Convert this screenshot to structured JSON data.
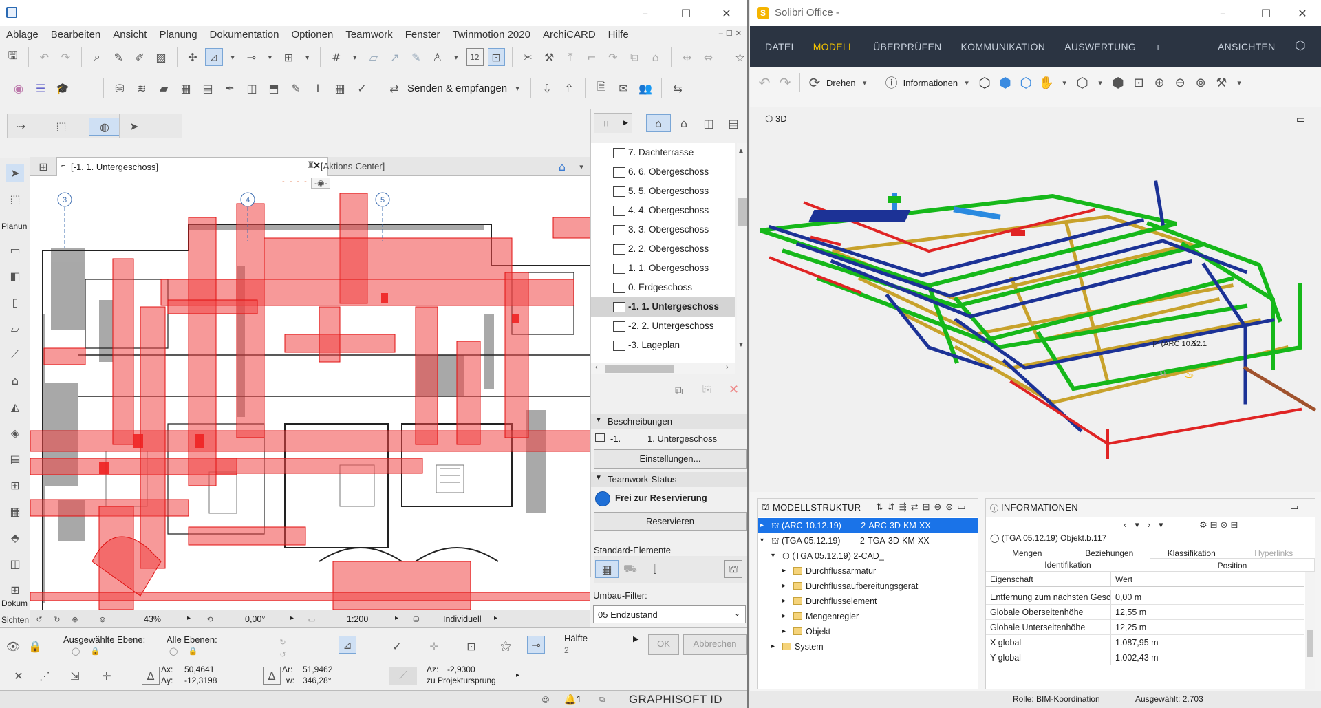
{
  "archicad": {
    "menu": [
      "Ablage",
      "Bearbeiten",
      "Ansicht",
      "Planung",
      "Dokumentation",
      "Optionen",
      "Teamwork",
      "Fenster",
      "Twinmotion 2020",
      "ArchiCARD",
      "Hilfe"
    ],
    "send_receive": "Senden & empfangen",
    "tabs": {
      "floorplan": "[-1. 1. Untergeschoss]",
      "action_center": "[Aktions-Center]"
    },
    "left_labels": {
      "planung": "Planun",
      "dokum": "Dokum",
      "sichten": "Sichten"
    },
    "grid_markers": [
      "3",
      "4",
      "5"
    ],
    "stories": [
      {
        "label": "7. Dachterrasse",
        "selected": false
      },
      {
        "label": "6. 6. Obergeschoss",
        "selected": false
      },
      {
        "label": "5. 5. Obergeschoss",
        "selected": false
      },
      {
        "label": "4. 4. Obergeschoss",
        "selected": false
      },
      {
        "label": "3. 3. Obergeschoss",
        "selected": false
      },
      {
        "label": "2. 2. Obergeschoss",
        "selected": false
      },
      {
        "label": "1. 1. Obergeschoss",
        "selected": false
      },
      {
        "label": "0. Erdgeschoss",
        "selected": false
      },
      {
        "label": "-1. 1. Untergeschoss",
        "selected": true
      },
      {
        "label": "-2. 2. Untergeschoss",
        "selected": false
      },
      {
        "label": "-3. Lageplan",
        "selected": false
      }
    ],
    "beschreibungen": {
      "title": "Beschreibungen",
      "num": "-1.",
      "name": "1. Untergeschoss",
      "settings": "Einstellungen..."
    },
    "teamwork": {
      "title": "Teamwork-Status",
      "status": "Frei zur Reservierung",
      "reserve": "Reservieren"
    },
    "standard_elements": "Standard-Elemente",
    "umbau": {
      "label": "Umbau-Filter:",
      "value": "05 Endzustand"
    },
    "status": {
      "zoom": "43%",
      "angle": "0,00°",
      "scale": "1:200",
      "view": "Individuell"
    },
    "layers": {
      "selected": "Ausgewählte Ebene:",
      "all": "Alle Ebenen:"
    },
    "ok": "OK",
    "cancel": "Abbrechen",
    "half": {
      "label": "Hälfte",
      "value": "2"
    },
    "coords": {
      "dx_label": "Δx:",
      "dx": "50,4641",
      "dy_label": "Δy:",
      "dy": "-12,3198",
      "dr_label": "Δr:",
      "dr": "51,9462",
      "w_label": "w:",
      "w": "346,28°",
      "dz_label": "Δz:",
      "dz": "-2,9300",
      "ref": "zu Projektursprung"
    },
    "notif": "1",
    "brand": "GRAPHISOFT ID"
  },
  "solibri": {
    "title": "Solibri Office -",
    "nav": [
      "DATEI",
      "MODELL",
      "ÜBERPRÜFEN",
      "KOMMUNIKATION",
      "AUSWERTUNG",
      "+"
    ],
    "nav_right": "ANSICHTEN",
    "tool_rotate": "Drehen",
    "tool_info": "Informationen",
    "view_label": "3D",
    "model_tag": "(ARC 10.12.1",
    "modellstruktur": {
      "title": "MODELLSTRUKTUR",
      "rows": [
        {
          "text": "(ARC 10.12.19)       -2-ARC-3D-KM-XX",
          "level": 0,
          "selected": true,
          "folder": false,
          "exp": "▸"
        },
        {
          "text": "(TGA 05.12.19)       -2-TGA-3D-KM-XX",
          "level": 0,
          "selected": false,
          "folder": false,
          "exp": "▾"
        },
        {
          "text": "(TGA 05.12.19) 2-CAD_",
          "level": 1,
          "selected": false,
          "folder": false,
          "exp": "▾"
        },
        {
          "text": "Durchflussarmatur",
          "level": 2,
          "selected": false,
          "folder": true,
          "exp": "▸"
        },
        {
          "text": "Durchflussaufbereitungsgerät",
          "level": 2,
          "selected": false,
          "folder": true,
          "exp": "▸"
        },
        {
          "text": "Durchflusselement",
          "level": 2,
          "selected": false,
          "folder": true,
          "exp": "▸"
        },
        {
          "text": "Mengenregler",
          "level": 2,
          "selected": false,
          "folder": true,
          "exp": "▸"
        },
        {
          "text": "Objekt",
          "level": 2,
          "selected": false,
          "folder": true,
          "exp": "▸"
        },
        {
          "text": "System",
          "level": 1,
          "selected": false,
          "folder": true,
          "exp": "▸"
        }
      ]
    },
    "informationen": {
      "title": "INFORMATIONEN",
      "object": "(TGA 05.12.19) Objekt.b.117",
      "tabs_top": [
        "Mengen",
        "Beziehungen",
        "Klassifikation",
        "Hyperlinks"
      ],
      "tabs_bottom": [
        "Identifikation",
        "Position"
      ],
      "col_property": "Eigenschaft",
      "col_value": "Wert",
      "rows": [
        {
          "k": "Entfernung zum nächsten Gesch...",
          "v": "0,00 m"
        },
        {
          "k": "Globale Oberseitenhöhe",
          "v": "12,55 m"
        },
        {
          "k": "Globale Unterseitenhöhe",
          "v": "12,25 m"
        },
        {
          "k": "X global",
          "v": "1.087,95 m"
        },
        {
          "k": "Y global",
          "v": "1.002,43 m"
        }
      ]
    },
    "status": {
      "role": "Rolle: BIM-Koordination",
      "selected": "Ausgewählt: 2.703"
    }
  }
}
